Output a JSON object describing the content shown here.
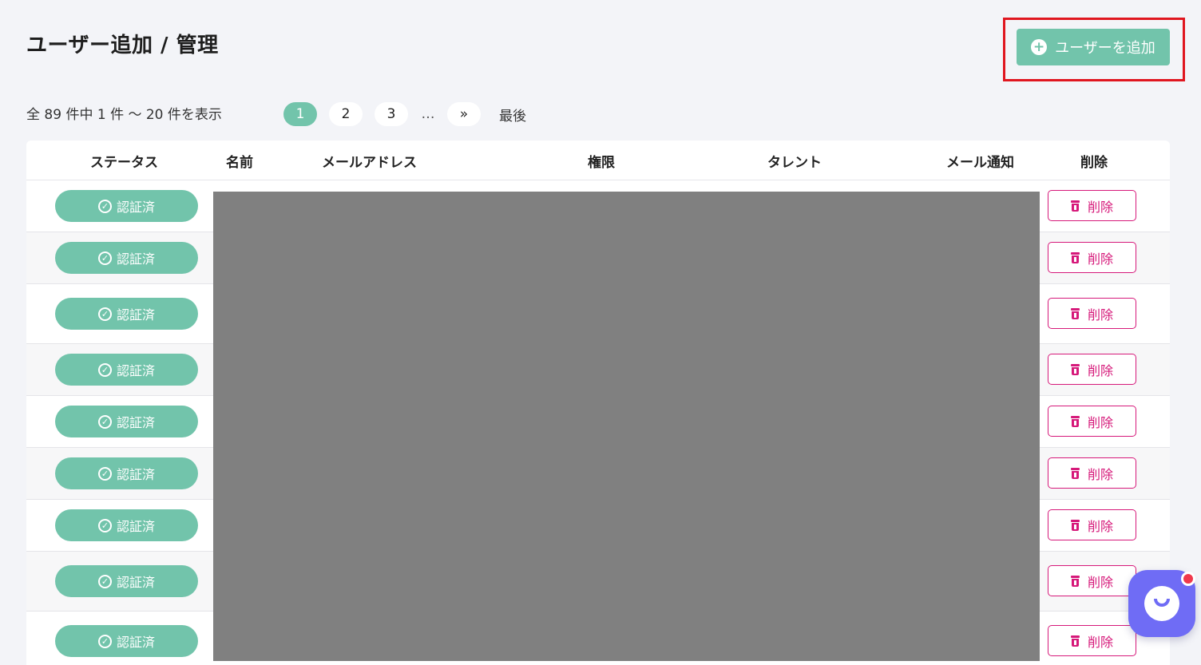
{
  "header": {
    "title": "ユーザー追加 / 管理",
    "add_user_label": "ユーザーを追加",
    "plus_glyph": "+"
  },
  "summary": {
    "count_text": "全 89 件中 1 件 ～ 20 件を表示"
  },
  "pagination": {
    "pages": [
      "1",
      "2",
      "3"
    ],
    "current": "1",
    "ellipsis": "…",
    "next": "»",
    "last": "最後"
  },
  "table": {
    "headers": {
      "status": "ステータス",
      "name": "名前",
      "email": "メールアドレス",
      "role": "権限",
      "talent": "タレント",
      "mail_notify": "メール通知",
      "delete": "削除"
    },
    "rows": [
      {
        "status": "認証済",
        "delete": "削除"
      },
      {
        "status": "認証済",
        "delete": "削除"
      },
      {
        "status": "認証済",
        "delete": "削除"
      },
      {
        "status": "認証済",
        "delete": "削除"
      },
      {
        "status": "認証済",
        "delete": "削除"
      },
      {
        "status": "認証済",
        "delete": "削除"
      },
      {
        "status": "認証済",
        "delete": "削除"
      },
      {
        "status": "認証済",
        "delete": "削除"
      },
      {
        "status": "認証済",
        "delete": "削除"
      }
    ]
  },
  "icons": {
    "check": "check-circle-icon",
    "trash": "trash-icon",
    "plus": "plus-circle-icon",
    "chat": "chat-icon"
  },
  "colors": {
    "accent": "#72c4ab",
    "danger": "#d6197a",
    "highlight": "#e0161f",
    "chat": "#6f6cf5",
    "redacted": "#808080"
  }
}
